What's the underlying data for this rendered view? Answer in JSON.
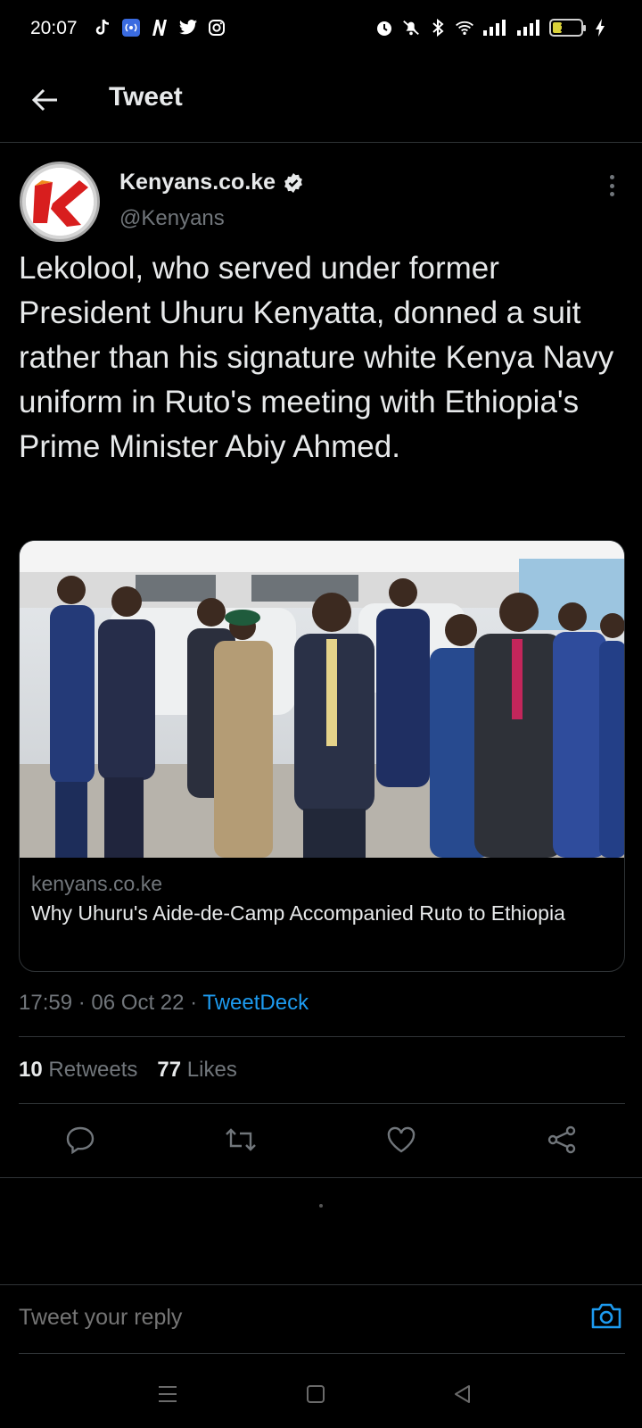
{
  "status_bar": {
    "time": "20:07",
    "battery": "28",
    "left_icons": [
      "tiktok-icon",
      "radio-icon",
      "n-app-icon",
      "twitter-icon",
      "instagram-icon"
    ],
    "right_icons": [
      "alarm-icon",
      "mute-icon",
      "bluetooth-icon",
      "wifi-icon",
      "signal-icon",
      "signal-icon",
      "battery-icon",
      "charging-icon"
    ]
  },
  "header": {
    "title": "Tweet"
  },
  "author": {
    "name": "Kenyans.co.ke",
    "handle": "@Kenyans",
    "verified": true
  },
  "tweet": {
    "text": "Lekolool, who served under former President Uhuru Kenyatta, donned a suit rather than his signature white Kenya Navy uniform in Ruto's meeting with Ethiopia's Prime Minister Abiy Ahmed."
  },
  "card": {
    "domain": "kenyans.co.ke",
    "title": "Why Uhuru's Aide-de-Camp Accompanied Ruto to Ethiopia"
  },
  "meta": {
    "time": "17:59",
    "date": "06 Oct 22",
    "separator": "·",
    "source": "TweetDeck"
  },
  "stats": {
    "retweets_count": "10",
    "retweets_label": "Retweets",
    "likes_count": "77",
    "likes_label": "Likes"
  },
  "reply": {
    "placeholder": "Tweet your reply"
  },
  "colors": {
    "background": "#000000",
    "text": "#e7e9ea",
    "secondary": "#71767b",
    "accent": "#1d9bf0",
    "divider": "#2f3336"
  }
}
